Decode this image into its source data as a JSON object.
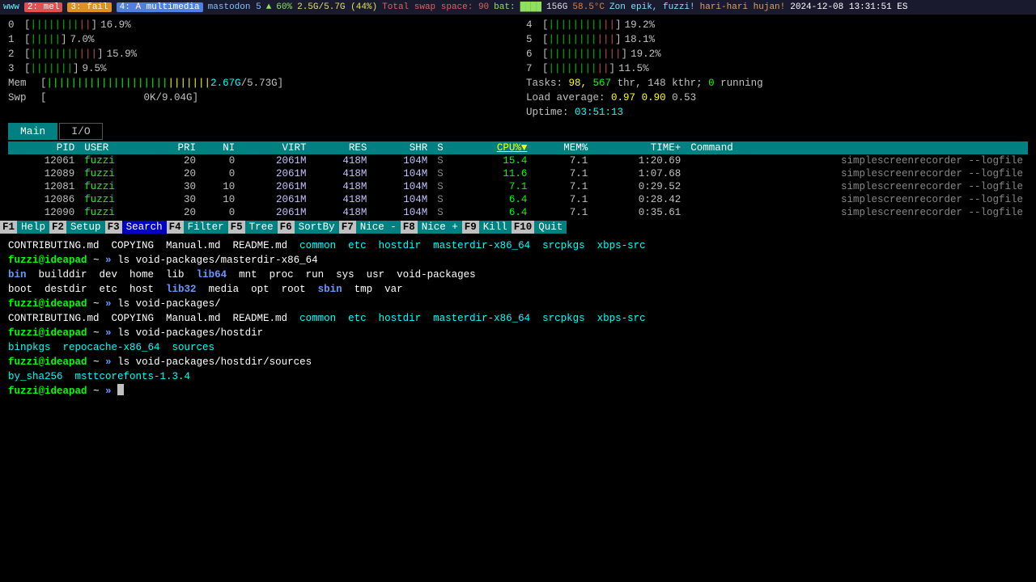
{
  "topbar": {
    "www": "www",
    "tag2": "2: mel",
    "tag3": "3: fail",
    "tag4": "4: A multimedia",
    "mastodon": "mastodon 5",
    "battery_icon": "▲",
    "battery": "60%",
    "mem": "2.5G/5.7G (44%)",
    "swap": "Total swap space: 90",
    "bat": "bat:",
    "bat_blocks": "████",
    "disk": "156G",
    "temp": "58.5°C",
    "zon": "Zon epik, fuzzi!",
    "hujan": "hari-hari hujan!",
    "datetime": "2024-12-08 13:31:51 ES"
  },
  "cpus": [
    {
      "id": "0",
      "fill": "||||||||",
      "fill_red": "||",
      "percent": "16.9%"
    },
    {
      "id": "1",
      "fill": "|||||",
      "fill_red": "",
      "percent": "7.0%"
    },
    {
      "id": "2",
      "fill": "||||||||",
      "fill_red": "|||",
      "percent": "15.9%"
    },
    {
      "id": "3",
      "fill": "|||||||",
      "fill_red": "",
      "percent": "9.5%"
    },
    {
      "id": "4",
      "fill": "|||||||||",
      "fill_red": "||",
      "percent": "19.2%"
    },
    {
      "id": "5",
      "fill": "||||||||",
      "fill_red": "|||",
      "percent": "18.1%"
    },
    {
      "id": "6",
      "fill": "|||||||||",
      "fill_red": "|||",
      "percent": "19.2%"
    },
    {
      "id": "7",
      "fill": "||||||||",
      "fill_red": "||",
      "percent": "11.5%"
    }
  ],
  "mem": {
    "label": "Mem",
    "used": "2.67G",
    "total": "5.73G",
    "bar_fill": "||||||||||||||||||||",
    "bar_yellow": "|||||||"
  },
  "swp": {
    "label": "Swp",
    "used": "0K",
    "total": "9.04G"
  },
  "stats": {
    "tasks_label": "Tasks:",
    "tasks_count": "98,",
    "thr": "567",
    "thr_label": "thr,",
    "kthr": "148",
    "kthr_label": "kthr;",
    "running": "0",
    "running_label": "running",
    "load_label": "Load average:",
    "load1": "0.97",
    "load5": "0.90",
    "load15": "0.53",
    "uptime_label": "Uptime:",
    "uptime": "03:51:13"
  },
  "tabs": [
    {
      "label": "Main",
      "active": true
    },
    {
      "label": "I/O",
      "active": false
    }
  ],
  "table": {
    "headers": [
      "PID",
      "USER",
      "PRI",
      "NI",
      "VIRT",
      "RES",
      "SHR",
      "S",
      "CPU%",
      "MEM%",
      "TIME+",
      "Command"
    ],
    "sorted_col": "CPU%",
    "rows": [
      {
        "pid": "12061",
        "user": "fuzzi",
        "pri": "20",
        "ni": "0",
        "virt": "2061M",
        "res": "418M",
        "shr": "104M",
        "s": "S",
        "cpu": "15.4",
        "mem": "7.1",
        "time": "1:20.69",
        "cmd": "simplescreenrecorder --logfile"
      },
      {
        "pid": "12089",
        "user": "fuzzi",
        "pri": "20",
        "ni": "0",
        "virt": "2061M",
        "res": "418M",
        "shr": "104M",
        "s": "S",
        "cpu": "11.6",
        "mem": "7.1",
        "time": "1:07.68",
        "cmd": "simplescreenrecorder --logfile"
      },
      {
        "pid": "12081",
        "user": "fuzzi",
        "pri": "30",
        "ni": "10",
        "virt": "2061M",
        "res": "418M",
        "shr": "104M",
        "s": "S",
        "cpu": "7.1",
        "mem": "7.1",
        "time": "0:29.52",
        "cmd": "simplescreenrecorder --logfile"
      },
      {
        "pid": "12086",
        "user": "fuzzi",
        "pri": "30",
        "ni": "10",
        "virt": "2061M",
        "res": "418M",
        "shr": "104M",
        "s": "S",
        "cpu": "6.4",
        "mem": "7.1",
        "time": "0:28.42",
        "cmd": "simplescreenrecorder --logfile"
      },
      {
        "pid": "12090",
        "user": "fuzzi",
        "pri": "20",
        "ni": "0",
        "virt": "2061M",
        "res": "418M",
        "shr": "104M",
        "s": "S",
        "cpu": "6.4",
        "mem": "7.1",
        "time": "0:35.61",
        "cmd": "simplescreenrecorder --logfile"
      }
    ]
  },
  "funcbar": [
    {
      "key": "F1",
      "label": "Help"
    },
    {
      "key": "F2",
      "label": "Setup"
    },
    {
      "key": "F3",
      "label": "Search",
      "highlight": true
    },
    {
      "key": "F4",
      "label": "Filter"
    },
    {
      "key": "F5",
      "label": "Tree"
    },
    {
      "key": "F6",
      "label": "SortBy"
    },
    {
      "key": "F7",
      "label": "Nice -"
    },
    {
      "key": "F8",
      "label": "Nice +"
    },
    {
      "key": "F9",
      "label": "Kill"
    },
    {
      "key": "F10",
      "label": "Quit"
    }
  ],
  "terminal": {
    "lines": [
      {
        "parts": [
          {
            "text": "CONTRIBUTING.md",
            "cls": "t-white"
          },
          {
            "text": "  COPYING  ",
            "cls": "t-white"
          },
          {
            "text": "Manual.md  README.md  ",
            "cls": "t-white"
          },
          {
            "text": "common  etc  hostdir  masterdir-x86_64  srcpkgs  xbps-src",
            "cls": "t-cyan"
          }
        ]
      },
      {
        "parts": [
          {
            "text": "fuzzi@ideapad",
            "cls": "t-bold-green"
          },
          {
            "text": " ~ ",
            "cls": "t-white"
          },
          {
            "text": "»",
            "cls": "t-bold-blue"
          },
          {
            "text": " ls void-packages/masterdir-x86_64",
            "cls": "t-white"
          }
        ]
      },
      {
        "parts": [
          {
            "text": "bin",
            "cls": "t-bold-blue"
          },
          {
            "text": "  builddir  ",
            "cls": "t-white"
          },
          {
            "text": "dev  home  ",
            "cls": "t-white"
          },
          {
            "text": "lib  ",
            "cls": "t-white"
          },
          {
            "text": "lib64",
            "cls": "t-bold-blue"
          },
          {
            "text": "  mnt  proc  run  sys  usr  ",
            "cls": "t-white"
          },
          {
            "text": "void-packages",
            "cls": "t-white"
          }
        ]
      },
      {
        "parts": [
          {
            "text": "boot  destdir  etc  host  ",
            "cls": "t-white"
          },
          {
            "text": "lib32",
            "cls": "t-bold-blue"
          },
          {
            "text": "  media  opt  root  ",
            "cls": "t-white"
          },
          {
            "text": "sbin",
            "cls": "t-bold-blue"
          },
          {
            "text": "  tmp  var",
            "cls": "t-white"
          }
        ]
      },
      {
        "parts": [
          {
            "text": "fuzzi@ideapad",
            "cls": "t-bold-green"
          },
          {
            "text": " ~ ",
            "cls": "t-white"
          },
          {
            "text": "»",
            "cls": "t-bold-blue"
          },
          {
            "text": " ls void-packages/",
            "cls": "t-white"
          }
        ]
      },
      {
        "parts": [
          {
            "text": "CONTRIBUTING.md  COPYING  Manual.md  README.md  ",
            "cls": "t-white"
          },
          {
            "text": "common  etc  hostdir  masterdir-x86_64  srcpkgs  xbps-src",
            "cls": "t-cyan"
          }
        ]
      },
      {
        "parts": [
          {
            "text": "fuzzi@ideapad",
            "cls": "t-bold-green"
          },
          {
            "text": " ~ ",
            "cls": "t-white"
          },
          {
            "text": "»",
            "cls": "t-bold-blue"
          },
          {
            "text": " ls void-packages/hostdir",
            "cls": "t-white"
          }
        ]
      },
      {
        "parts": [
          {
            "text": "binpkgs  repocache-x86_64  sources",
            "cls": "t-cyan"
          }
        ]
      },
      {
        "parts": [
          {
            "text": "fuzzi@ideapad",
            "cls": "t-bold-green"
          },
          {
            "text": " ~ ",
            "cls": "t-white"
          },
          {
            "text": "»",
            "cls": "t-bold-blue"
          },
          {
            "text": " ls void-packages/hostdir/sources",
            "cls": "t-white"
          }
        ]
      },
      {
        "parts": [
          {
            "text": "by_sha256  msttcorefonts-1.3.4",
            "cls": "t-cyan"
          }
        ]
      },
      {
        "parts": [
          {
            "text": "fuzzi@ideapad",
            "cls": "t-bold-green"
          },
          {
            "text": " ~ ",
            "cls": "t-white"
          },
          {
            "text": "»",
            "cls": "t-bold-blue"
          },
          {
            "text": " ",
            "cls": "t-white"
          },
          {
            "text": "CURSOR",
            "cls": "cursor-marker"
          }
        ]
      }
    ]
  }
}
